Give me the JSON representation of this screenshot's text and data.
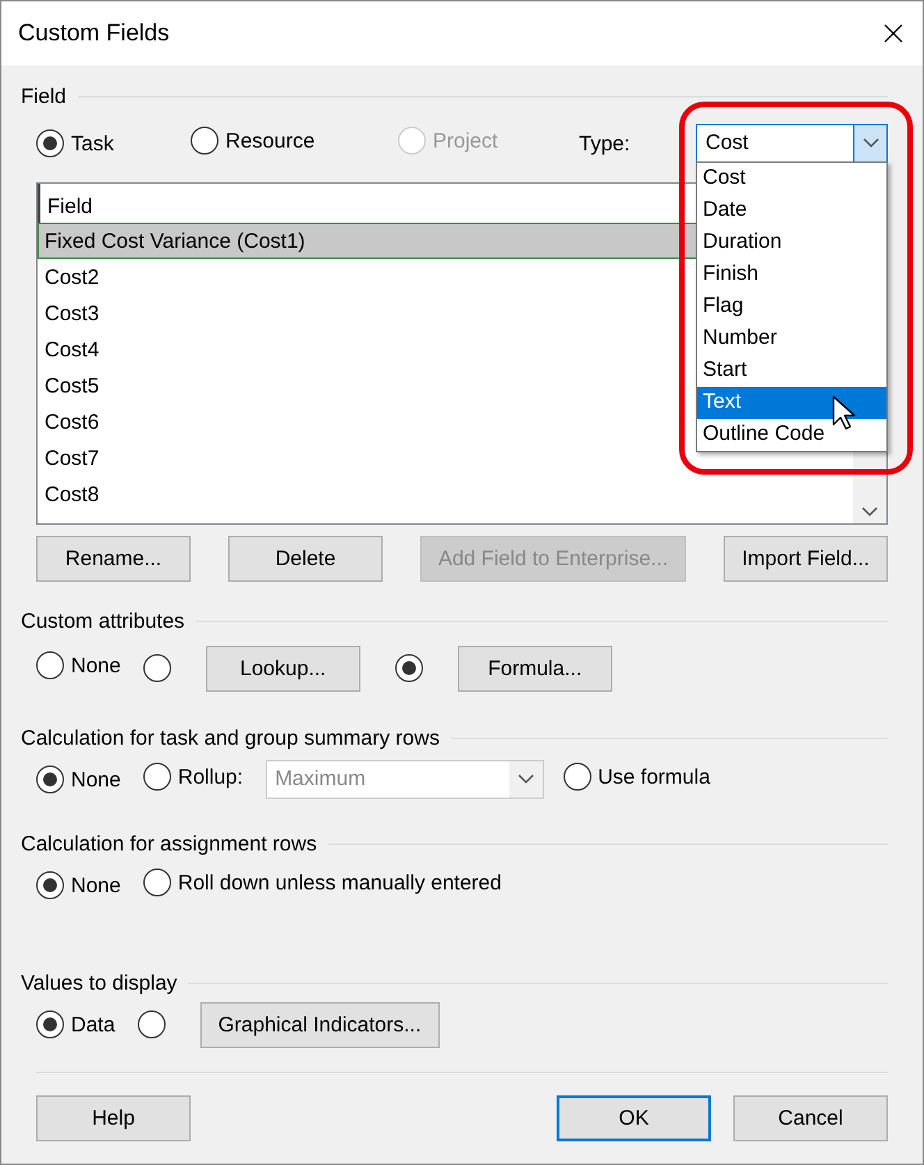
{
  "window": {
    "title": "Custom Fields"
  },
  "field_section": {
    "label": "Field",
    "scopes": [
      {
        "label": "Task",
        "selected": true,
        "disabled": false
      },
      {
        "label": "Resource",
        "selected": false,
        "disabled": false
      },
      {
        "label": "Project",
        "selected": false,
        "disabled": true
      }
    ],
    "type_label": "Type:",
    "type_value": "Cost",
    "type_options": [
      {
        "label": "Cost",
        "selected": false
      },
      {
        "label": "Date",
        "selected": false
      },
      {
        "label": "Duration",
        "selected": false
      },
      {
        "label": "Finish",
        "selected": false
      },
      {
        "label": "Flag",
        "selected": false
      },
      {
        "label": "Number",
        "selected": false
      },
      {
        "label": "Start",
        "selected": false
      },
      {
        "label": "Text",
        "selected": true
      },
      {
        "label": "Outline Code",
        "selected": false
      }
    ],
    "table": {
      "columns": [
        "Field"
      ],
      "rows": [
        {
          "name": "Fixed Cost Variance (Cost1)",
          "selected": true
        },
        {
          "name": "Cost2",
          "selected": false
        },
        {
          "name": "Cost3",
          "selected": false
        },
        {
          "name": "Cost4",
          "selected": false
        },
        {
          "name": "Cost5",
          "selected": false
        },
        {
          "name": "Cost6",
          "selected": false
        },
        {
          "name": "Cost7",
          "selected": false
        },
        {
          "name": "Cost8",
          "selected": false
        }
      ]
    },
    "buttons": [
      {
        "label": "Rename...",
        "disabled": false
      },
      {
        "label": "Delete",
        "disabled": false
      },
      {
        "label": "Add Field to Enterprise...",
        "disabled": true
      },
      {
        "label": "Import Field...",
        "disabled": false
      }
    ]
  },
  "sections": [
    {
      "label": "Custom attributes",
      "items": [
        {
          "kind": "radio",
          "label": "None",
          "selected": false
        },
        {
          "kind": "radio-button",
          "button": "Lookup...",
          "selected": false
        },
        {
          "kind": "radio-button",
          "button": "Formula...",
          "selected": true
        }
      ]
    },
    {
      "label": "Calculation for task and group summary rows",
      "items": [
        {
          "kind": "radio",
          "label": "None",
          "selected": true
        },
        {
          "kind": "radio",
          "label": "Rollup:",
          "selected": false
        },
        {
          "kind": "dropdown",
          "value": "Maximum",
          "disabled": true
        },
        {
          "kind": "radio",
          "label": "Use formula",
          "selected": false
        }
      ]
    },
    {
      "label": "Calculation for assignment rows",
      "items": [
        {
          "kind": "radio",
          "label": "None",
          "selected": true
        },
        {
          "kind": "radio",
          "label": "Roll down unless manually entered",
          "selected": false
        }
      ]
    },
    {
      "label": "Values to display",
      "items": [
        {
          "kind": "radio",
          "label": "Data",
          "selected": true
        },
        {
          "kind": "radio-button",
          "button": "Graphical Indicators...",
          "selected": false
        }
      ]
    }
  ],
  "footer": [
    {
      "label": "Help",
      "default": false
    },
    {
      "label": "OK",
      "default": true
    },
    {
      "label": "Cancel",
      "default": false
    }
  ]
}
